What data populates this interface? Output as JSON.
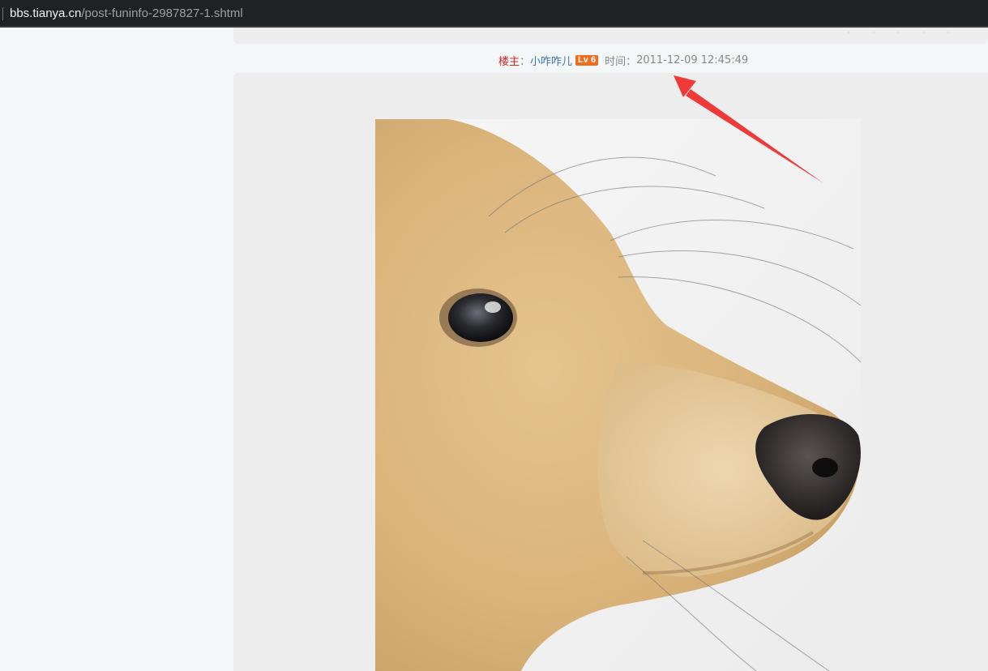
{
  "browser": {
    "url_domain": "bbs.tianya.cn",
    "url_path": "/post-funinfo-2987827-1.shtml"
  },
  "post": {
    "owner_label": "楼主",
    "colon": "：",
    "username": "小咋咋儿",
    "level_badge": "Lv 6",
    "time_label": "时间：",
    "timestamp": "2011-12-09 12:45:49"
  },
  "image": {
    "subject": "dog-photo"
  },
  "annotation": {
    "arrow_color": "#f03a3a"
  },
  "colors": {
    "owner_label": "#d8231f",
    "username_link": "#3c6fb8",
    "level_badge_bg": "#f26c1d"
  }
}
